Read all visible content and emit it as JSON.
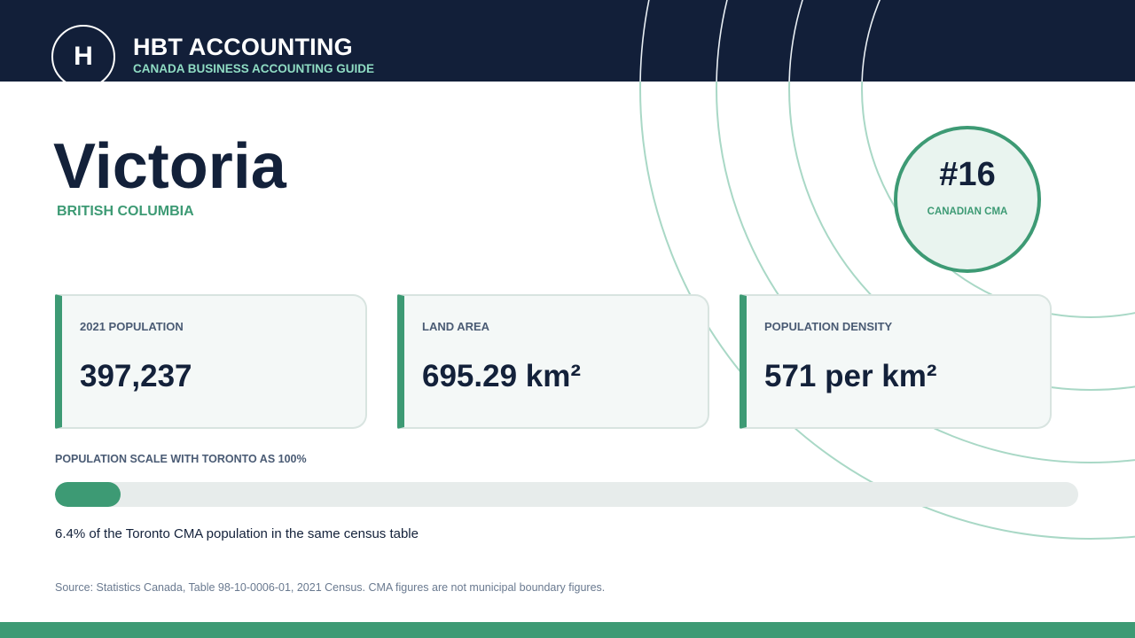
{
  "brand": {
    "logo_letter": "H",
    "name": "HBT ACCOUNTING",
    "tagline": "CANADA BUSINESS ACCOUNTING GUIDE"
  },
  "city": {
    "name": "Victoria",
    "province": "BRITISH COLUMBIA"
  },
  "rank": {
    "value": "#16",
    "label": "CANADIAN CMA"
  },
  "stats": [
    {
      "label": "2021 POPULATION",
      "value": "397,237"
    },
    {
      "label": "LAND AREA",
      "value": "695.29 km²"
    },
    {
      "label": "POPULATION DENSITY",
      "value": "571 per km²"
    }
  ],
  "population_scale": {
    "title": "POPULATION SCALE WITH TORONTO AS 100%",
    "percent_of_toronto": 6.4,
    "caption": "6.4% of the Toronto CMA population in the same census table"
  },
  "source": "Source: Statistics Canada, Table 98-10-0006-01, 2021 Census. CMA figures are not municipal boundary figures.",
  "colors": {
    "navy": "#121f39",
    "accent_green": "#3d9a74",
    "mint": "#8fdcc3",
    "card_background": "#f4f8f7",
    "ring_stroke": "#a9d8c6"
  },
  "icons": {
    "logo": "letter-h-circle-logo"
  }
}
